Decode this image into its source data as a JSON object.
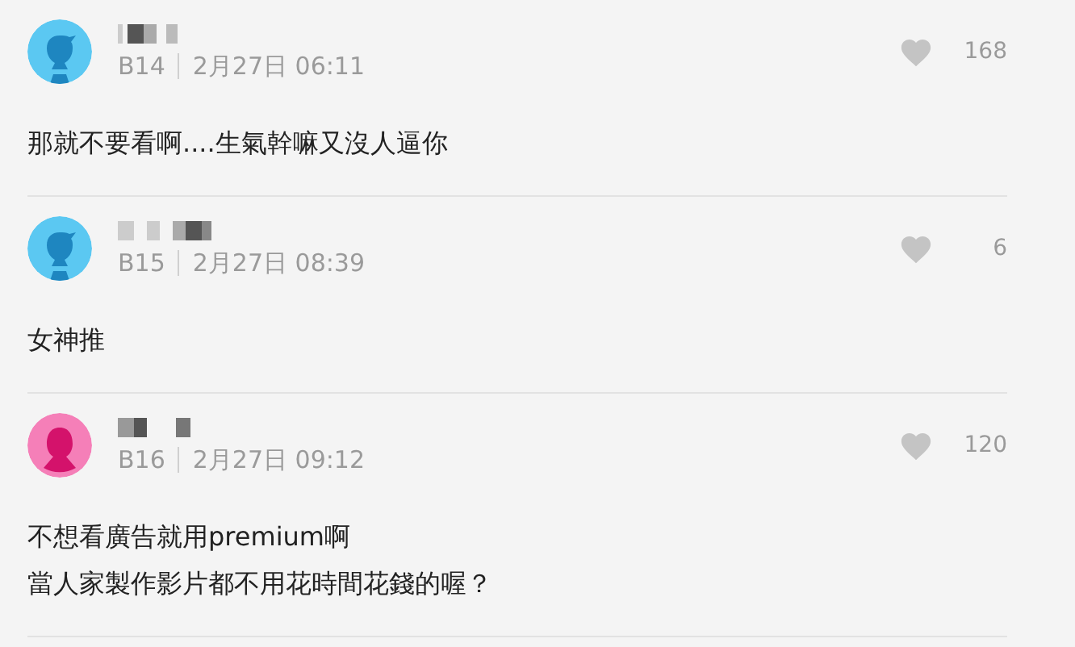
{
  "comments": [
    {
      "avatar": {
        "kind": "male"
      },
      "floor": "B14",
      "time": "2月27日 06:11",
      "likes": "168",
      "body": [
        "那就不要看啊....生氣幹嘛又沒人逼你"
      ]
    },
    {
      "avatar": {
        "kind": "male"
      },
      "floor": "B15",
      "time": "2月27日 08:39",
      "likes": "6",
      "body": [
        "女神推"
      ]
    },
    {
      "avatar": {
        "kind": "female"
      },
      "floor": "B16",
      "time": "2月27日 09:12",
      "likes": "120",
      "body": [
        "不想看廣告就用premium啊",
        "當人家製作影片都不用花時間花錢的喔？"
      ]
    }
  ]
}
